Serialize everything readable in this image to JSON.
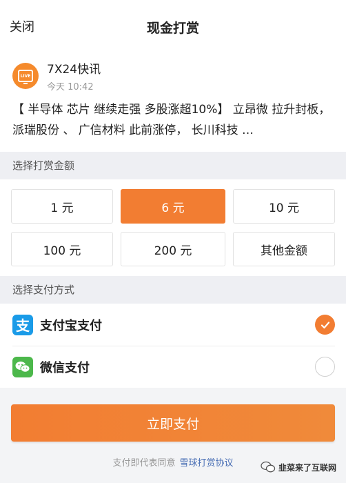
{
  "header": {
    "close_label": "关闭",
    "title": "现金打赏"
  },
  "post": {
    "avatar_text": "LIVE",
    "author": "7X24快讯",
    "time": "今天 10:42",
    "body": "【 半导体 芯片 继续走强 多股涨超10%】 立昂微 拉升封板， 派瑞股份 、 广信材料 此前涨停， 长川科技 …"
  },
  "amount_section": {
    "label": "选择打赏金额",
    "options": [
      "1 元",
      "6 元",
      "10 元",
      "100 元",
      "200 元",
      "其他金额"
    ],
    "selected_index": 1
  },
  "payment_section": {
    "label": "选择支付方式",
    "methods": [
      {
        "label": "支付宝支付",
        "icon": "alipay-icon",
        "glyph": "支",
        "selected": true
      },
      {
        "label": "微信支付",
        "icon": "wechat-icon",
        "glyph": "",
        "selected": false
      }
    ]
  },
  "submit_label": "立即支付",
  "agreement": {
    "text": "支付即代表同意",
    "link": "雪球打赏协议"
  },
  "watermark": "韭菜来了互联网",
  "colors": {
    "accent": "#f27d32",
    "alipay": "#1a9be8",
    "wechat": "#4cb84b",
    "link": "#4a6fb5"
  }
}
